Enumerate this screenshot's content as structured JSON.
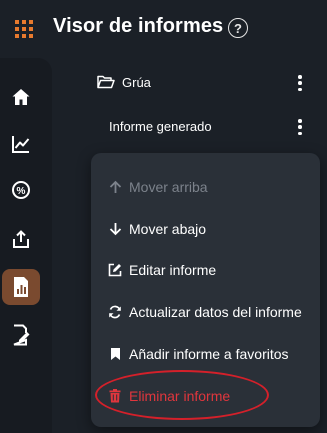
{
  "app": {
    "title": "Visor de informes",
    "help_glyph": "?"
  },
  "colors": {
    "background": "#1b2027",
    "rail": "#171b21",
    "menu": "#2a3038",
    "accent": "#e87a2e",
    "active_rail": "#7a4a2f",
    "danger": "#e0363d",
    "disabled": "#7c828b"
  },
  "rail": {
    "items": [
      {
        "icon": "home-icon"
      },
      {
        "icon": "line-chart-icon"
      },
      {
        "icon": "percent-icon"
      },
      {
        "icon": "share-icon"
      },
      {
        "icon": "report-icon",
        "active": true
      },
      {
        "icon": "edit-document-icon"
      }
    ]
  },
  "tree": {
    "folder": {
      "label": "Grúa",
      "icon": "folder-open-icon"
    },
    "report": {
      "label": "Informe generado"
    }
  },
  "menu": {
    "items": [
      {
        "label": "Mover arriba",
        "icon": "arrow-up-icon",
        "disabled": true
      },
      {
        "label": "Mover abajo",
        "icon": "arrow-down-icon"
      },
      {
        "label": "Editar informe",
        "icon": "edit-icon"
      },
      {
        "label": "Actualizar datos del informe",
        "icon": "refresh-icon"
      },
      {
        "label": "Añadir informe a favoritos",
        "icon": "bookmark-icon"
      },
      {
        "label": "Eliminar informe",
        "icon": "trash-icon",
        "danger": true
      }
    ]
  }
}
